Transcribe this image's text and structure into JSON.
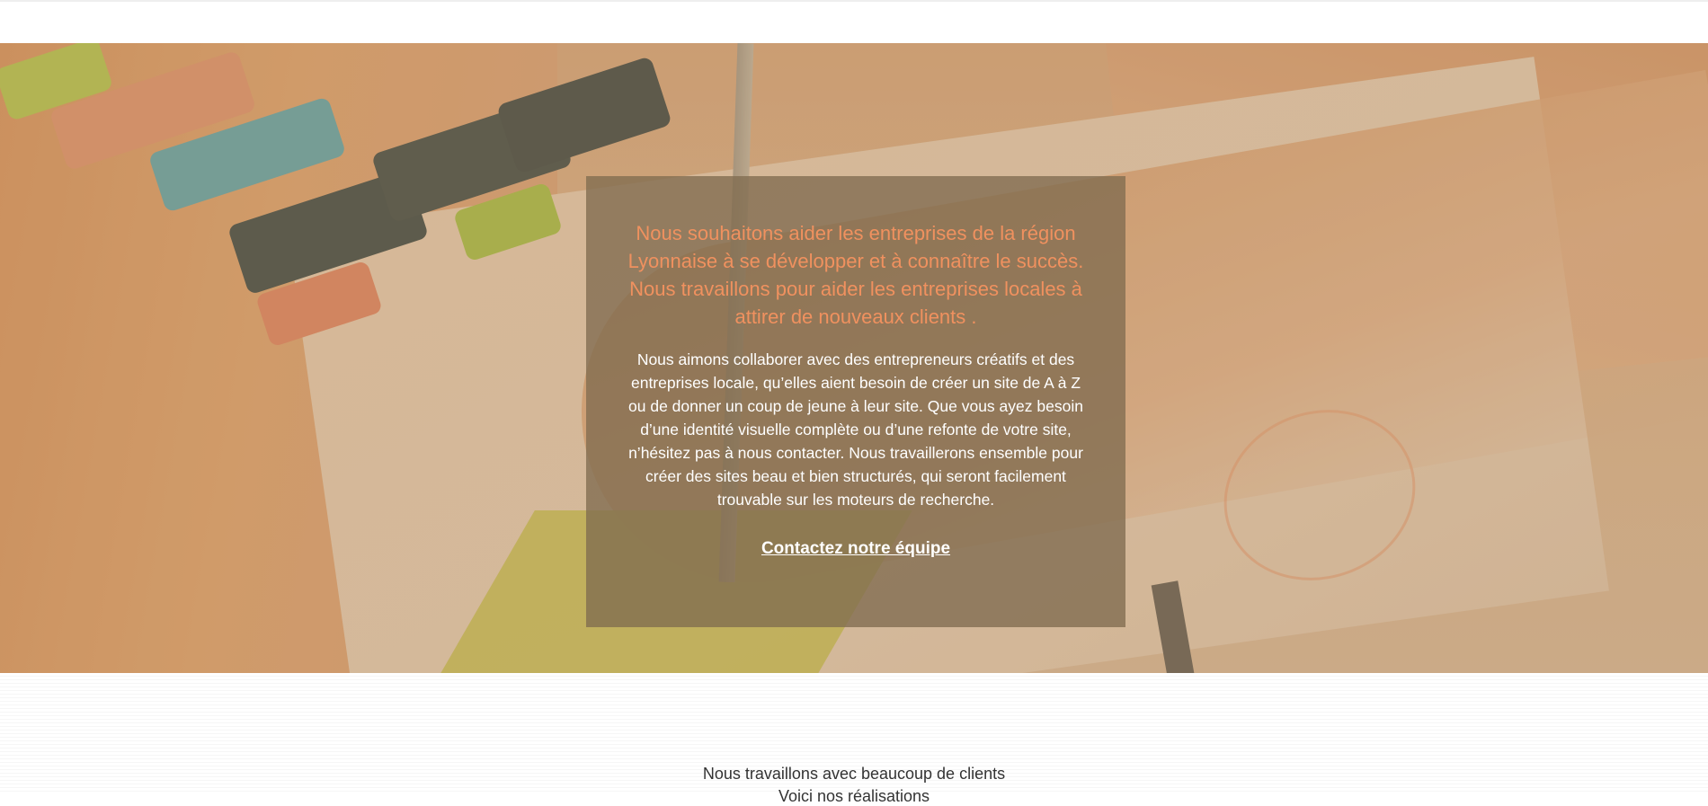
{
  "hero": {
    "heading": "Nous souhaitons aider les entreprises de la région Lyonnaise à se développer et à connaître le succès. Nous travaillons pour aider les entreprises locales à attirer de nouveaux clients .",
    "body": "Nous aimons collaborer avec des entrepreneurs créatifs et des entreprises locale, qu’elles aient besoin de créer un site de A à Z ou de donner un coup de jeune à leur site. Que vous ayez besoin d’une identité visuelle complète ou d’une refonte de votre site, n’hésitez pas à nous contacter. Nous travaillerons ensemble pour créer des sites beau et bien structurés, qui seront facilement trouvable sur les moteurs de recherche.",
    "cta_label": "Contactez notre équipe",
    "colors": {
      "heading": "#f0915f",
      "card_background": "rgba(128,108,80,0.78)"
    }
  },
  "clients_section": {
    "line1": "Nous travaillons avec beaucoup de clients",
    "line2": "Voici nos réalisations"
  }
}
